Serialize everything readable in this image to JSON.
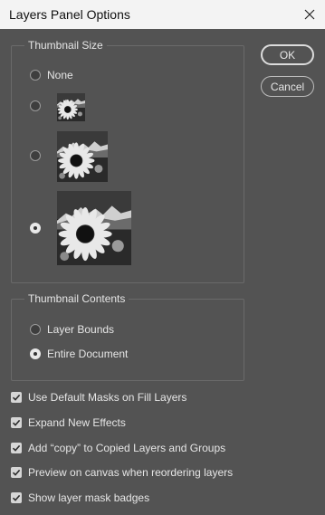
{
  "dialog": {
    "title": "Layers Panel Options"
  },
  "icons": {
    "close": "close-icon",
    "check": "checkmark-icon",
    "thumbnail": "sunflower-mountain-thumbnail"
  },
  "thumbnail_size": {
    "legend": "Thumbnail Size",
    "options": [
      {
        "id": "none",
        "label": "None",
        "selected": false
      },
      {
        "id": "small",
        "label": "",
        "selected": false
      },
      {
        "id": "medium",
        "label": "",
        "selected": false
      },
      {
        "id": "large",
        "label": "",
        "selected": true
      }
    ]
  },
  "thumbnail_contents": {
    "legend": "Thumbnail Contents",
    "options": [
      {
        "label": "Layer Bounds",
        "selected": false
      },
      {
        "label": "Entire Document",
        "selected": true
      }
    ]
  },
  "checkboxes": [
    {
      "label": "Use Default Masks on Fill Layers",
      "checked": true
    },
    {
      "label": "Expand New Effects",
      "checked": true
    },
    {
      "label": "Add “copy” to Copied Layers and Groups",
      "checked": true
    },
    {
      "label": "Preview on canvas when reordering layers",
      "checked": true
    },
    {
      "label": "Show layer mask badges",
      "checked": true
    }
  ],
  "buttons": {
    "ok": "OK",
    "cancel": "Cancel"
  }
}
